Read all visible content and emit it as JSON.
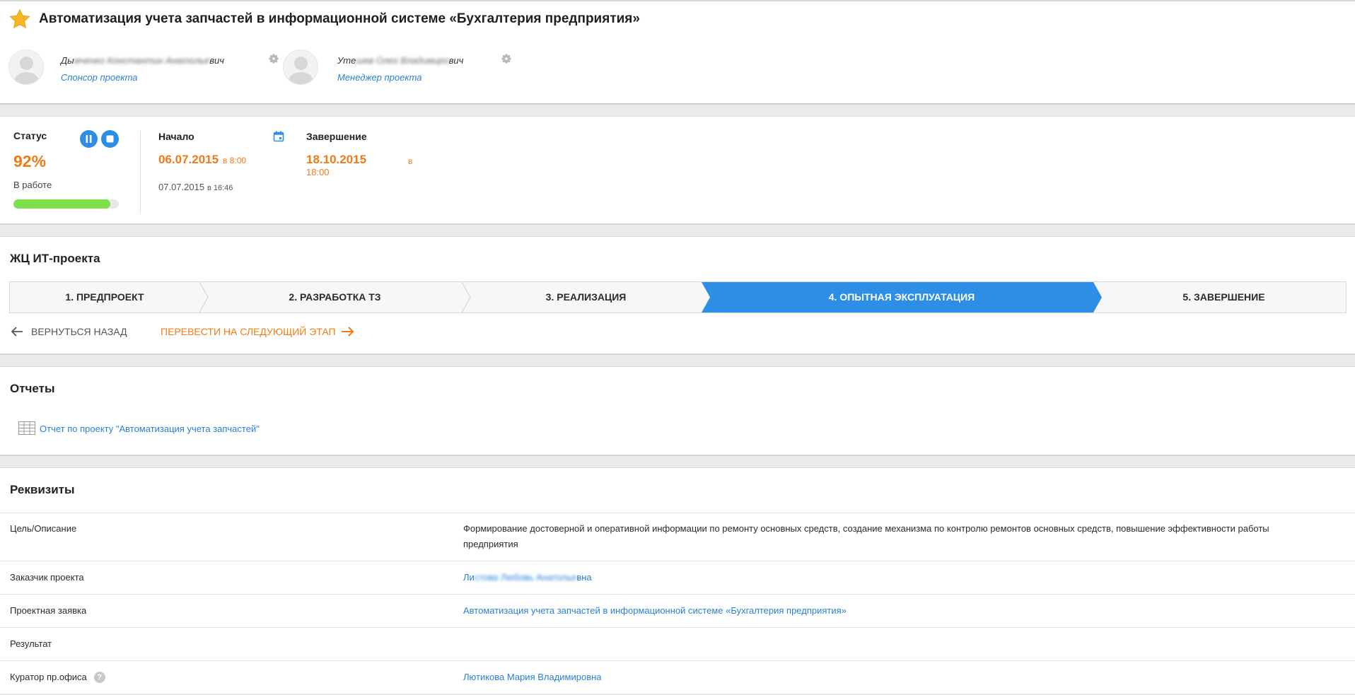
{
  "header": {
    "title": "Автоматизация учета запчастей в информационной системе «Бухгалтерия предприятия»",
    "sponsor": {
      "name_visible_start": "Ды",
      "name_blurred": "мченко Константин Анатолье",
      "name_visible_end": "вич",
      "role": "Спонсор проекта"
    },
    "manager": {
      "name_visible_start": "Уте",
      "name_blurred": "шев Олег Владимиро",
      "name_visible_end": "вич",
      "role": "Менеджер проекта"
    }
  },
  "status": {
    "label": "Статус",
    "percent": "92%",
    "state": "В работе",
    "progress": 0.92,
    "start_label": "Начало",
    "start_date": "06.07.2015",
    "start_time": "в 8:00",
    "start_fact_date": "07.07.2015",
    "start_fact_time": "в 16:46",
    "end_label": "Завершение",
    "end_date": "18.10.2015",
    "end_in": "в",
    "end_time": "18:00"
  },
  "lifecycle": {
    "title": "ЖЦ ИТ-проекта",
    "stages": [
      "1. ПРЕДПРОЕКТ",
      "2. РАЗРАБОТКА ТЗ",
      "3. РЕАЛИЗАЦИЯ",
      "4. ОПЫТНАЯ ЭКСПЛУАТАЦИЯ",
      "5. ЗАВЕРШЕНИЕ"
    ],
    "active_stage": 4,
    "back_label": "ВЕРНУТЬСЯ НАЗАД",
    "next_label": "ПЕРЕВЕСТИ НА СЛЕДУЮЩИЙ ЭТАП"
  },
  "reports": {
    "title": "Отчеты",
    "link": "Отчет по проекту \"Автоматизация учета запчастей\""
  },
  "requisites": {
    "title": "Реквизиты",
    "rows": [
      {
        "key": "Цель/Описание",
        "value": "Формирование достоверной и оперативной информации по ремонту основных средств, создание механизма по контролю ремонтов основных средств, повышение эффективности работы предприятия"
      },
      {
        "key": "Заказчик проекта",
        "value_start": "Ли",
        "value_blurred": "стова Любовь Анатолье",
        "value_end": "вна"
      },
      {
        "key": "Проектная заявка",
        "value": "Автоматизация учета запчастей в информационной системе «Бухгалтерия предприятия»"
      },
      {
        "key": "Результат",
        "value": ""
      },
      {
        "key": "Куратор пр.офиса",
        "value": "Лютикова Мария Владимировна"
      }
    ]
  },
  "colors": {
    "accent": "#2d8ee6",
    "orange": "#f07b16",
    "progress": "#7ee14a",
    "link": "#2a7fd4"
  }
}
